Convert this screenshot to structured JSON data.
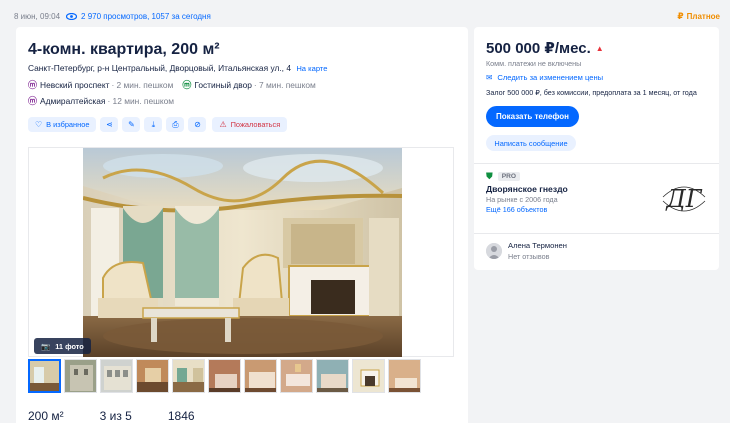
{
  "topbar": {
    "date": "8 июн, 09:04",
    "views": "2 970 просмотров, 1057 за сегодня",
    "paid_label": "Платное"
  },
  "listing": {
    "title": "4-комн. квартира, 200 м²",
    "address": "Санкт-Петербург, р-н Центральный, Дворцовый, Итальянская ул., 4",
    "map_link": "На карте",
    "metro": [
      {
        "name": "Невский проспект",
        "time": "· 2 мин. пешком",
        "icon": "metro-icon",
        "color": "#8f3fa0"
      },
      {
        "name": "Гостиный двор",
        "time": "· 7 мин. пешком",
        "icon": "metro-icon",
        "color": "#0f8f40"
      },
      {
        "name": "Адмиралтейская",
        "time": "· 12 мин. пешком",
        "icon": "metro-icon",
        "color": "#8f3fa0"
      }
    ],
    "actions": {
      "favorite": "В избранное",
      "report": "Пожаловаться"
    },
    "photo_count": "11 фото",
    "params": [
      "200 м²",
      "3 из 5",
      "1846"
    ]
  },
  "sidebar": {
    "price": "500 000 ₽/мес.",
    "price_note": "Комм. платежи не включены",
    "follow_price": "Следить за изменением цены",
    "terms": "Залог 500 000 ₽, без комиссии, предоплата за 1 месяц, от года",
    "show_phone": "Показать телефон",
    "write_message": "Написать сообщение",
    "agency": {
      "badge": "PRO",
      "name": "Дворянское гнездо",
      "since": "На рынке с 2006 года",
      "more": "Ещё 166 объектов",
      "logo_text": "ДГ"
    },
    "agent": {
      "name": "Алена Термонен",
      "reviews": "Нет отзывов"
    }
  },
  "colors": {
    "accent": "#0468ff",
    "paid": "#f08d00",
    "danger": "#d23545",
    "text": "#152242",
    "muted": "#7a7f8c"
  }
}
